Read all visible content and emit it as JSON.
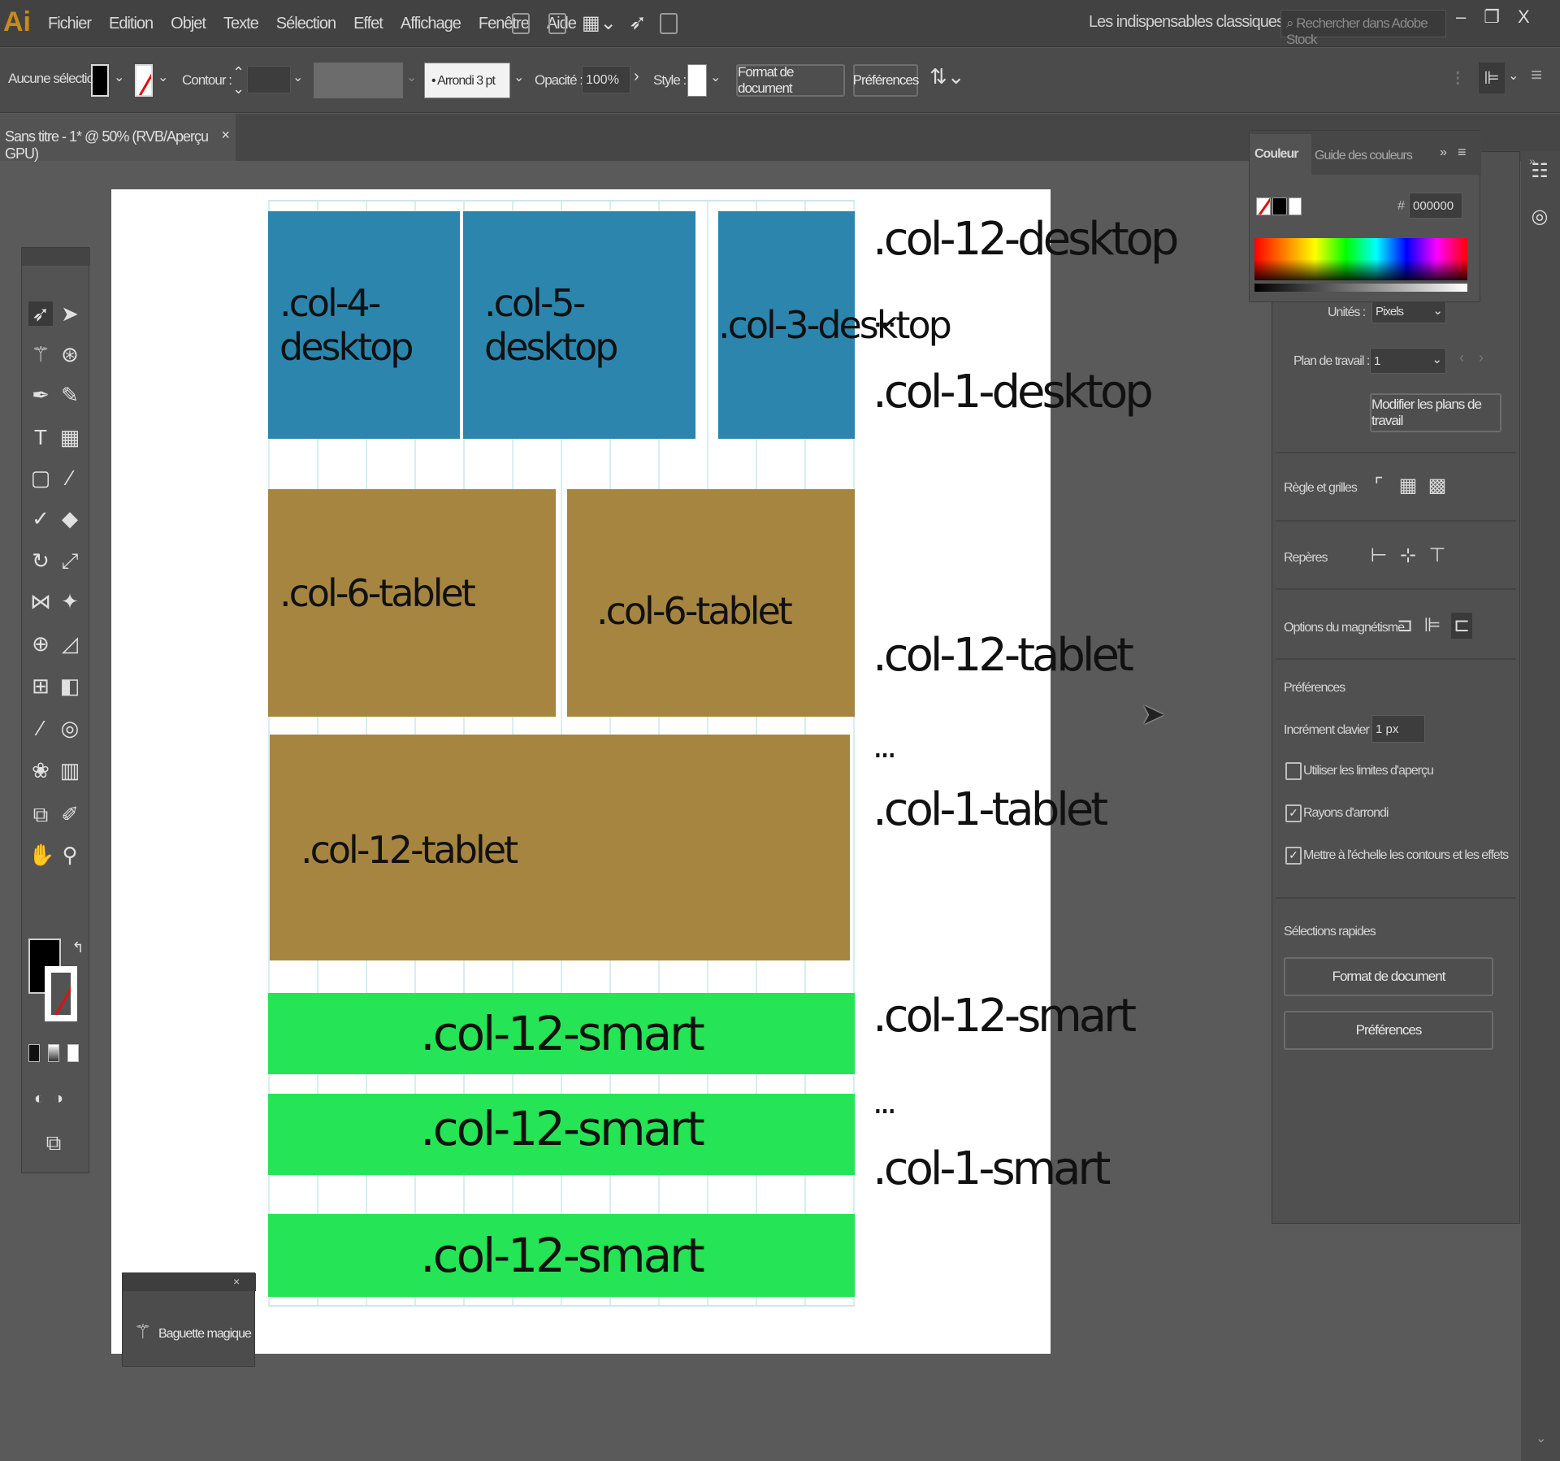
{
  "app": {
    "logo": "Ai"
  },
  "menu": [
    "Fichier",
    "Edition",
    "Objet",
    "Texte",
    "Sélection",
    "Effet",
    "Affichage",
    "Fenêtre",
    "Aide"
  ],
  "workspace": {
    "label": "Les indispensables classiques",
    "chevron": "⌄"
  },
  "search": {
    "placeholder": "Rechercher dans Adobe Stock"
  },
  "window": {
    "minimize": "–",
    "restore": "❐",
    "close": "X"
  },
  "control": {
    "selection": "Aucune sélection",
    "stroke_label": "Contour :",
    "brush": "Arrondi 3 pt",
    "opacity_label": "Opacité :",
    "opacity_value": "100%",
    "style_label": "Style :",
    "doc_format": "Format de document",
    "preferences": "Préférences"
  },
  "tab": {
    "title": "Sans titre - 1* @ 50% (RVB/Aperçu GPU)",
    "close": "×"
  },
  "canvas": {
    "desktop": [
      ".col-4-desktop",
      ".col-5-desktop",
      ".col-3-desktop"
    ],
    "tablet_row1": [
      ".col-6-tablet",
      ".col-6-tablet"
    ],
    "tablet_row2": ".col-12-tablet",
    "smart": [
      ".col-12-smart",
      ".col-12-smart",
      ".col-12-smart"
    ],
    "notes": {
      "d1": ".col-12-desktop",
      "d2": "...",
      "d3": ".col-1-desktop",
      "t1": ".col-12-tablet",
      "t2": "...",
      "t3": ".col-1-tablet",
      "s1": ".col-12-smart",
      "s2": "...",
      "s3": ".col-1-smart"
    }
  },
  "color_panel": {
    "tab1": "Couleur",
    "tab2": "Guide des couleurs",
    "hex": "000000"
  },
  "properties": {
    "units_label": "Unités :",
    "units_value": "Pixels",
    "artboard_label": "Plan de travail :",
    "artboard_value": "1",
    "edit_artboards": "Modifier les plans de travail",
    "rulers": "Règle et grilles",
    "guides": "Repères",
    "snap": "Options du magnétisme",
    "prefs_title": "Préférences",
    "keyboard_increment_label": "Incrément clavier :",
    "keyboard_increment_value": "1 px",
    "preview_bounds": "Utiliser les limites d'aperçu",
    "round_corners": "Rayons d'arrondi",
    "scale_strokes": "Mettre à l'échelle les contours et les effets",
    "quick_actions": "Sélections rapides",
    "doc_format": "Format de document",
    "preferences": "Préférences"
  },
  "wand_panel": {
    "label": "Baguette magique"
  },
  "checks": {
    "preview_bounds": false,
    "round_corners": true,
    "scale_strokes": true
  },
  "colors": {
    "blue": "#2b85ad",
    "brown": "#a58540",
    "green": "#25e455",
    "accent_logo": "#c98a1c"
  }
}
